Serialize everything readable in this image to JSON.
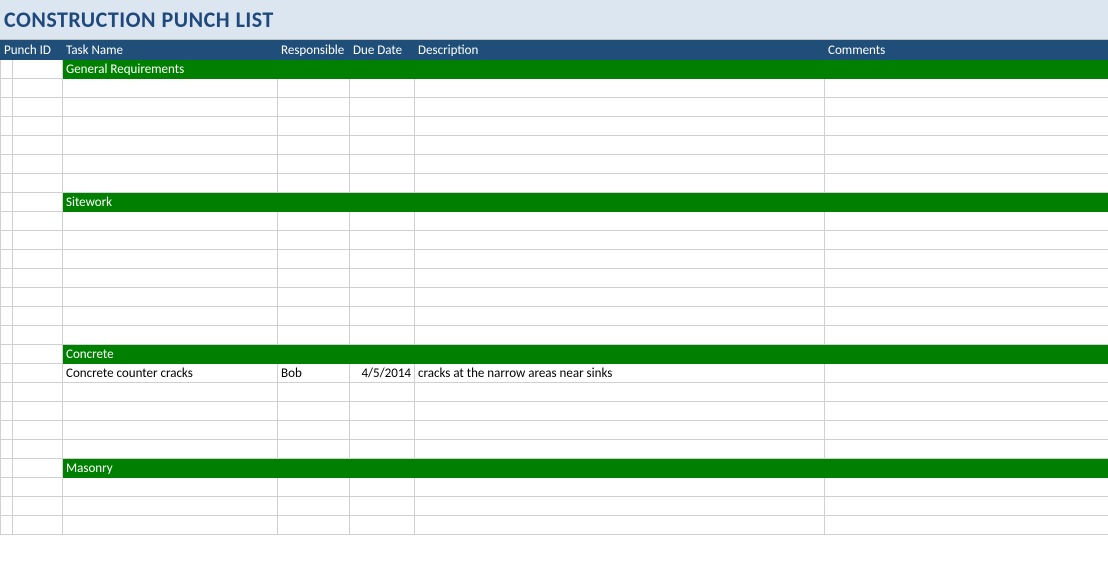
{
  "title": "CONSTRUCTION PUNCH LIST",
  "columns": {
    "punch_id": "Punch ID",
    "task_name": "Task Name",
    "responsible": "Responsible",
    "due_date": "Due Date",
    "description": "Description",
    "comments": "Comments"
  },
  "sections": [
    {
      "name": "General Requirements",
      "rows": [
        {
          "punch_id": "",
          "task_name": "",
          "responsible": "",
          "due_date": "",
          "description": "",
          "comments": ""
        },
        {
          "punch_id": "",
          "task_name": "",
          "responsible": "",
          "due_date": "",
          "description": "",
          "comments": ""
        },
        {
          "punch_id": "",
          "task_name": "",
          "responsible": "",
          "due_date": "",
          "description": "",
          "comments": ""
        },
        {
          "punch_id": "",
          "task_name": "",
          "responsible": "",
          "due_date": "",
          "description": "",
          "comments": ""
        },
        {
          "punch_id": "",
          "task_name": "",
          "responsible": "",
          "due_date": "",
          "description": "",
          "comments": ""
        },
        {
          "punch_id": "",
          "task_name": "",
          "responsible": "",
          "due_date": "",
          "description": "",
          "comments": ""
        }
      ]
    },
    {
      "name": "Sitework",
      "rows": [
        {
          "punch_id": "",
          "task_name": "",
          "responsible": "",
          "due_date": "",
          "description": "",
          "comments": ""
        },
        {
          "punch_id": "",
          "task_name": "",
          "responsible": "",
          "due_date": "",
          "description": "",
          "comments": ""
        },
        {
          "punch_id": "",
          "task_name": "",
          "responsible": "",
          "due_date": "",
          "description": "",
          "comments": ""
        },
        {
          "punch_id": "",
          "task_name": "",
          "responsible": "",
          "due_date": "",
          "description": "",
          "comments": ""
        },
        {
          "punch_id": "",
          "task_name": "",
          "responsible": "",
          "due_date": "",
          "description": "",
          "comments": ""
        },
        {
          "punch_id": "",
          "task_name": "",
          "responsible": "",
          "due_date": "",
          "description": "",
          "comments": ""
        },
        {
          "punch_id": "",
          "task_name": "",
          "responsible": "",
          "due_date": "",
          "description": "",
          "comments": ""
        }
      ]
    },
    {
      "name": "Concrete",
      "rows": [
        {
          "punch_id": "",
          "task_name": "Concrete counter cracks",
          "responsible": "Bob",
          "due_date": "4/5/2014",
          "description": "cracks at the narrow areas near sinks",
          "comments": ""
        },
        {
          "punch_id": "",
          "task_name": "",
          "responsible": "",
          "due_date": "",
          "description": "",
          "comments": ""
        },
        {
          "punch_id": "",
          "task_name": "",
          "responsible": "",
          "due_date": "",
          "description": "",
          "comments": ""
        },
        {
          "punch_id": "",
          "task_name": "",
          "responsible": "",
          "due_date": "",
          "description": "",
          "comments": ""
        },
        {
          "punch_id": "",
          "task_name": "",
          "responsible": "",
          "due_date": "",
          "description": "",
          "comments": ""
        }
      ]
    },
    {
      "name": "Masonry",
      "rows": [
        {
          "punch_id": "",
          "task_name": "",
          "responsible": "",
          "due_date": "",
          "description": "",
          "comments": ""
        },
        {
          "punch_id": "",
          "task_name": "",
          "responsible": "",
          "due_date": "",
          "description": "",
          "comments": ""
        },
        {
          "punch_id": "",
          "task_name": "",
          "responsible": "",
          "due_date": "",
          "description": "",
          "comments": ""
        }
      ]
    }
  ]
}
